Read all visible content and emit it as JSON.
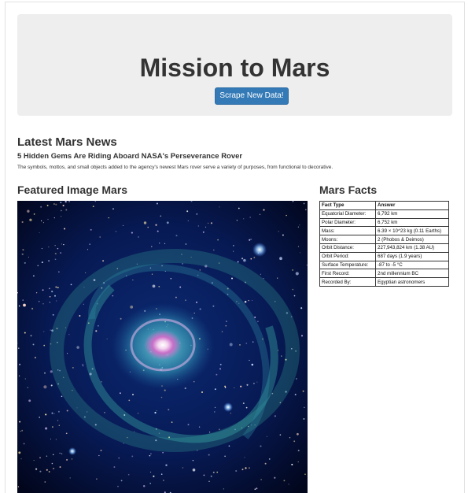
{
  "header": {
    "title": "Mission to Mars",
    "scrape_button": "Scrape New Data!"
  },
  "news": {
    "section_title": "Latest Mars News",
    "headline": "5 Hidden Gems Are Riding Aboard NASA's Perseverance Rover",
    "teaser": "The symbols, mottos, and small objects added to the agency's newest Mars rover serve a variety of purposes, from functional to decorative."
  },
  "featured_image": {
    "section_title": "Featured Image Mars",
    "icon": "spiral-galaxy-image"
  },
  "facts": {
    "section_title": "Mars Facts",
    "headers": [
      "Fact Type",
      "Answer"
    ],
    "rows": [
      [
        "Equatorial Diameter:",
        "6,792 km"
      ],
      [
        "Polar Diameter:",
        "6,752 km"
      ],
      [
        "Mass:",
        "6.39 × 10^23 kg (0.11 Earths)"
      ],
      [
        "Moons:",
        "2 (Phobos & Deimos)"
      ],
      [
        "Orbit Distance:",
        "227,943,824 km (1.38 AU)"
      ],
      [
        "Orbit Period:",
        "687 days (1.9 years)"
      ],
      [
        "Surface Temperature:",
        "-87 to -5 °C"
      ],
      [
        "First Record:",
        "2nd millennium BC"
      ],
      [
        "Recorded By:",
        "Egyptian astronomers"
      ]
    ]
  },
  "colors": {
    "button": "#337ab7",
    "jumbotron": "#eeeeee"
  }
}
